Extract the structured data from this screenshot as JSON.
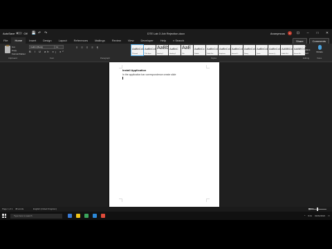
{
  "app": {
    "title": "DTE Lab 3 Job Rejection.docx",
    "autosave_label": "AutoSave",
    "autosave_state": "Off",
    "user_name": "Anonymous",
    "user_initials": "A"
  },
  "tabs": [
    "File",
    "Home",
    "Insert",
    "Design",
    "Layout",
    "References",
    "Mailings",
    "Review",
    "View",
    "Developer",
    "Help"
  ],
  "active_tab": "Home",
  "search_label": "Search",
  "share_label": "Share",
  "comments_label": "Comments",
  "ribbon": {
    "paste_label": "Paste",
    "cut_label": "Cut",
    "copy_label": "Copy",
    "format_painter_label": "Format Painter",
    "font_name": "Calibri (Body)",
    "font_size": "11",
    "font_buttons": "B I U ab x₂ x²",
    "para_buttons": "≡ ≡ ≡ ≡ ¶",
    "editing": {
      "find": "Find",
      "replace": "Replace",
      "select": "Select"
    },
    "dictate_label": "Dictate",
    "section_labels": {
      "clipboard": "Clipboard",
      "font": "Font",
      "paragraph": "Paragraph",
      "styles": "Styles",
      "editing": "Editing",
      "voice": "Voice"
    },
    "styles": [
      {
        "sample": "AaBbCcDc",
        "name": "¶ Normal",
        "big": false
      },
      {
        "sample": "AaBbCcDc",
        "name": "¶ No Spac...",
        "big": false
      },
      {
        "sample": "AaBb",
        "name": "Heading 1",
        "big": true
      },
      {
        "sample": "AaBbC",
        "name": "Heading 2",
        "big": false
      },
      {
        "sample": "AaE",
        "name": "Title",
        "big": true
      },
      {
        "sample": "AaBbCc",
        "name": "Subtitle",
        "big": false
      },
      {
        "sample": "AaBbCcD",
        "name": "Subtle Em...",
        "big": false
      },
      {
        "sample": "AaBbCcD",
        "name": "Emphasis",
        "big": false
      },
      {
        "sample": "AaBbCcD",
        "name": "Intense E...",
        "big": false
      },
      {
        "sample": "AaBbCcD",
        "name": "Strong",
        "big": false
      },
      {
        "sample": "AaBbCcD",
        "name": "Quote",
        "big": false
      },
      {
        "sample": "AaBbCcD",
        "name": "Intense Q...",
        "big": false
      },
      {
        "sample": "AABBCcD",
        "name": "Subtle Ref...",
        "big": false
      },
      {
        "sample": "AABBCcD",
        "name": "Intense Re...",
        "big": false
      }
    ]
  },
  "document": {
    "heading": "Install Application",
    "body": "In the application bar correspondence create slide"
  },
  "statusbar": {
    "page": "Page 1 of 1",
    "words": "48 words",
    "language": "English (United Kingdom)",
    "focus": "Focus",
    "zoom": "100%"
  },
  "taskbar": {
    "search_placeholder": "Type here to search",
    "time": "9:41",
    "date": "01/01/2021",
    "icon_colors": [
      "#3a7bd5",
      "#f0c419",
      "#3ba55c",
      "#2b88d8",
      "#e04b3a"
    ]
  },
  "colors": {
    "accent": "#4aa3df",
    "ribbon_bg": "#2a2a2a",
    "doc_bg": "#1f1f1f"
  }
}
